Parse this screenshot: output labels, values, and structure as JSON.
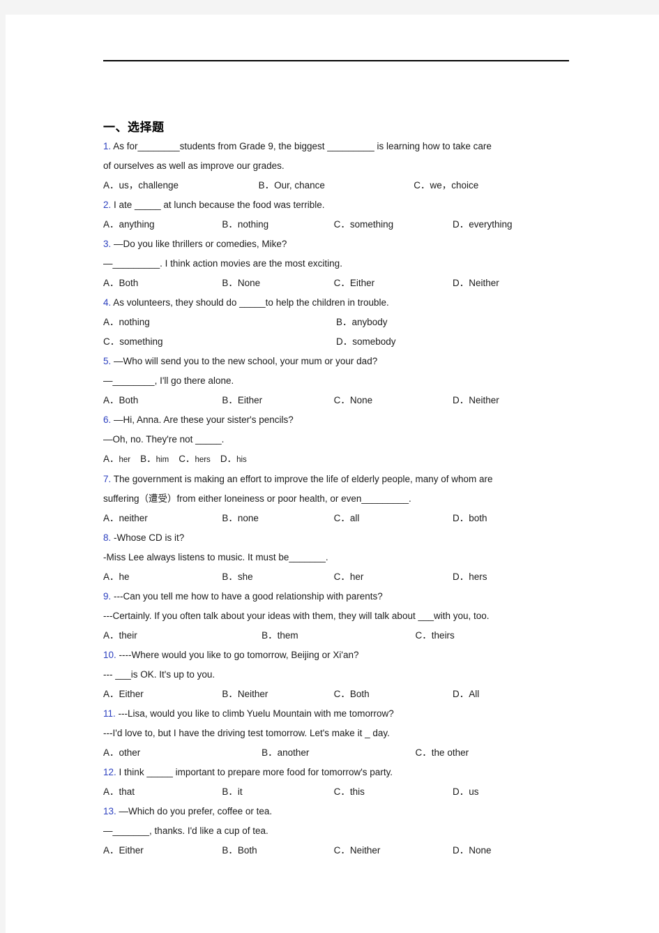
{
  "document": {
    "section_heading": "一、选择题",
    "questions": [
      {
        "number": "1.",
        "stem_lines": [
          "As for________students from Grade 9, the biggest _________ is learning how to take care",
          "of ourselves as well as improve our grades."
        ],
        "options": [
          "A．us，challenge",
          "B．Our, chance",
          "C．we，choice"
        ],
        "layout": "cols3"
      },
      {
        "number": "2.",
        "stem_lines": [
          "I ate _____ at lunch because the food was terrible."
        ],
        "options": [
          "A．anything",
          "B．nothing",
          "C．something",
          "D．everything"
        ],
        "layout": "cols4"
      },
      {
        "number": "3.",
        "stem_lines": [
          "—Do you like thrillers or comedies, Mike?",
          "—_________. I think action movies are the most exciting."
        ],
        "options": [
          "A．Both",
          "B．None",
          "C．Either",
          "D．Neither"
        ],
        "layout": "cols4"
      },
      {
        "number": "4.",
        "stem_lines": [
          "As volunteers, they should do _____to help the children in trouble."
        ],
        "options": [
          "A．nothing",
          "B．anybody",
          "C．something",
          "D．somebody"
        ],
        "layout": "cols2"
      },
      {
        "number": "5.",
        "stem_lines": [
          "—Who will send you to the new school, your mum or your dad?",
          "—________, I'll go there alone."
        ],
        "options": [
          "A．Both",
          "B．Either",
          "C．None",
          "D．Neither"
        ],
        "layout": "cols4"
      },
      {
        "number": "6.",
        "stem_lines": [
          "—Hi, Anna. Are these your sister's pencils?",
          "—Oh, no. They're not _____."
        ],
        "options": [
          "A．her",
          "B．him",
          "C．hers",
          "D．his"
        ],
        "layout": "inline"
      },
      {
        "number": "7.",
        "stem_lines": [
          "The government is making an effort to improve the life of elderly people, many of whom are",
          "suffering（遭受）from either loneiness or poor health, or even_________."
        ],
        "options": [
          "A．neither",
          "B．none",
          "C．all",
          "D．both"
        ],
        "layout": "cols4"
      },
      {
        "number": "8.",
        "stem_lines": [
          "-Whose CD is it?",
          "-Miss Lee always listens to music. It must be_______."
        ],
        "options": [
          "A．he",
          "B．she",
          "C．her",
          "D．hers"
        ],
        "layout": "cols4"
      },
      {
        "number": "9.",
        "stem_lines": [
          "---Can you tell me how to have a good relationship with parents?",
          "---Certainly. If you often talk about your ideas with them, they will talk about    ___with you, too."
        ],
        "options": [
          "A．their",
          "B．them",
          "C．theirs"
        ],
        "layout": "cols3b"
      },
      {
        "number": "10.",
        "stem_lines": [
          "----Where would you like to go tomorrow, Beijing or Xi'an?",
          "--- ___is OK. It's up to you."
        ],
        "options": [
          "A．Either",
          "B．Neither",
          "C．Both",
          "D．All"
        ],
        "layout": "cols4"
      },
      {
        "number": "11.",
        "stem_lines": [
          "---Lisa, would you like to climb Yuelu Mountain with me tomorrow?",
          "---I'd love to, but I have the driving test tomorrow. Let's make it _ day."
        ],
        "options": [
          "A．other",
          "B．another",
          "C．the other"
        ],
        "layout": "cols3b"
      },
      {
        "number": "12.",
        "stem_lines": [
          "I think _____ important to prepare more food for tomorrow's party."
        ],
        "options": [
          "A．that",
          "B．it",
          "C．this",
          "D．us"
        ],
        "layout": "cols4"
      },
      {
        "number": "13.",
        "stem_lines": [
          "—Which do you prefer, coffee or tea.",
          "—_______, thanks. I'd like a cup of tea."
        ],
        "options": [
          "A．Either",
          "B．Both",
          "C．Neither",
          "D．None"
        ],
        "layout": "cols4"
      }
    ]
  }
}
